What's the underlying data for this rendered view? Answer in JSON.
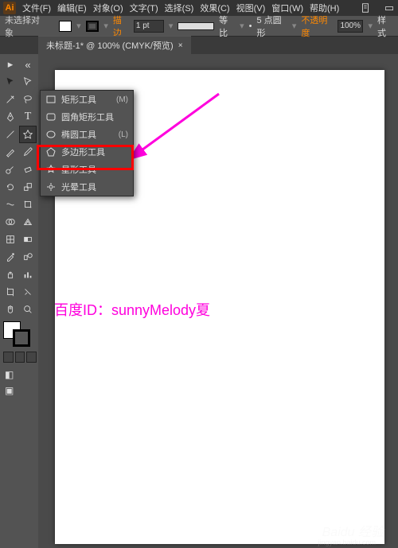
{
  "app_logo": "Ai",
  "menus": [
    "文件(F)",
    "编辑(E)",
    "对象(O)",
    "文字(T)",
    "选择(S)",
    "效果(C)",
    "视图(V)",
    "窗口(W)",
    "帮助(H)"
  ],
  "options": {
    "no_selection": "未选择对象",
    "stroke_label": "描边",
    "stroke_pt": "1 pt",
    "profile_label": "等比",
    "dot_round": "5 点圆形",
    "opacity_label": "不透明度",
    "opacity_val": "100%",
    "style_label": "样式"
  },
  "doc_tab": {
    "title": "未标题-1* @ 100% (CMYK/预览)",
    "close": "×"
  },
  "flyout": {
    "items": [
      {
        "icon": "rect",
        "label": "矩形工具",
        "shortcut": "(M)"
      },
      {
        "icon": "round-rect",
        "label": "圆角矩形工具",
        "shortcut": ""
      },
      {
        "icon": "ellipse",
        "label": "椭圆工具",
        "shortcut": "(L)"
      },
      {
        "icon": "polygon",
        "label": "多边形工具",
        "shortcut": ""
      },
      {
        "icon": "star",
        "label": "星形工具",
        "shortcut": ""
      },
      {
        "icon": "flare",
        "label": "光晕工具",
        "shortcut": ""
      }
    ]
  },
  "watermark": "百度ID：sunnyMelody夏",
  "baidu_wm": "Baidu 经验",
  "baidu_sub": "jingyan.baidu.com"
}
